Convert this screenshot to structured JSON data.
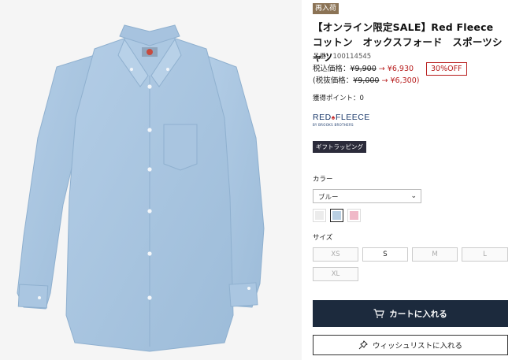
{
  "product": {
    "badge": "再入荷",
    "title": "【オンライン限定SALE】Red Fleece　コットン　オックスフォード　スポーツシャツ",
    "sku": "品番：100114545",
    "price_tax_in_label": "税込価格：",
    "price_tax_in_orig": "¥9,900",
    "price_tax_in_sale": "¥6,930",
    "price_tax_ex_label": "(税抜価格：",
    "price_tax_ex_orig": "¥9,000",
    "price_tax_ex_sale": "¥6,300)",
    "arrow": "→",
    "discount": "30%OFF",
    "points": "獲得ポイント：0"
  },
  "brand": {
    "name_left": "RED",
    "name_right": "FLEECE",
    "sub": "BY BROOKS BROTHERS"
  },
  "gift_tag": "ギフトラッピング",
  "color": {
    "label": "カラー",
    "selected": "ブルー",
    "swatches": [
      {
        "name": "white",
        "hex": "#ececec"
      },
      {
        "name": "blue",
        "hex": "#b9cfe2"
      },
      {
        "name": "pink",
        "hex": "#f0b8c8"
      }
    ]
  },
  "size": {
    "label": "サイズ",
    "options": [
      "XS",
      "S",
      "M",
      "L",
      "XL"
    ]
  },
  "actions": {
    "cart": "カートに入れる",
    "wishlist": "ウィッシュリストに入れる"
  },
  "colors": {
    "accent": "#b71c1c",
    "cart_bg": "#1c2a3d",
    "shirt": "#a8c4df"
  }
}
